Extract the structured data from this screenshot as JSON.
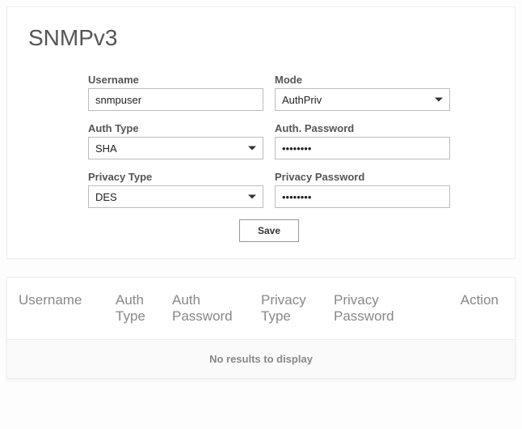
{
  "title": "SNMPv3",
  "form": {
    "username_label": "Username",
    "username_value": "snmpuser",
    "mode_label": "Mode",
    "mode_value": "AuthPriv",
    "auth_type_label": "Auth Type",
    "auth_type_value": "SHA",
    "auth_password_label": "Auth. Password",
    "auth_password_value": "••••••••",
    "privacy_type_label": "Privacy Type",
    "privacy_type_value": "DES",
    "privacy_password_label": "Privacy Password",
    "privacy_password_value": "••••••••",
    "save_label": "Save"
  },
  "table": {
    "headers": {
      "username": "Username",
      "auth_type": "Auth Type",
      "auth_password": "Auth Password",
      "privacy_type": "Privacy Type",
      "privacy_password": "Privacy Password",
      "action": "Action"
    },
    "empty_text": "No results to display"
  }
}
